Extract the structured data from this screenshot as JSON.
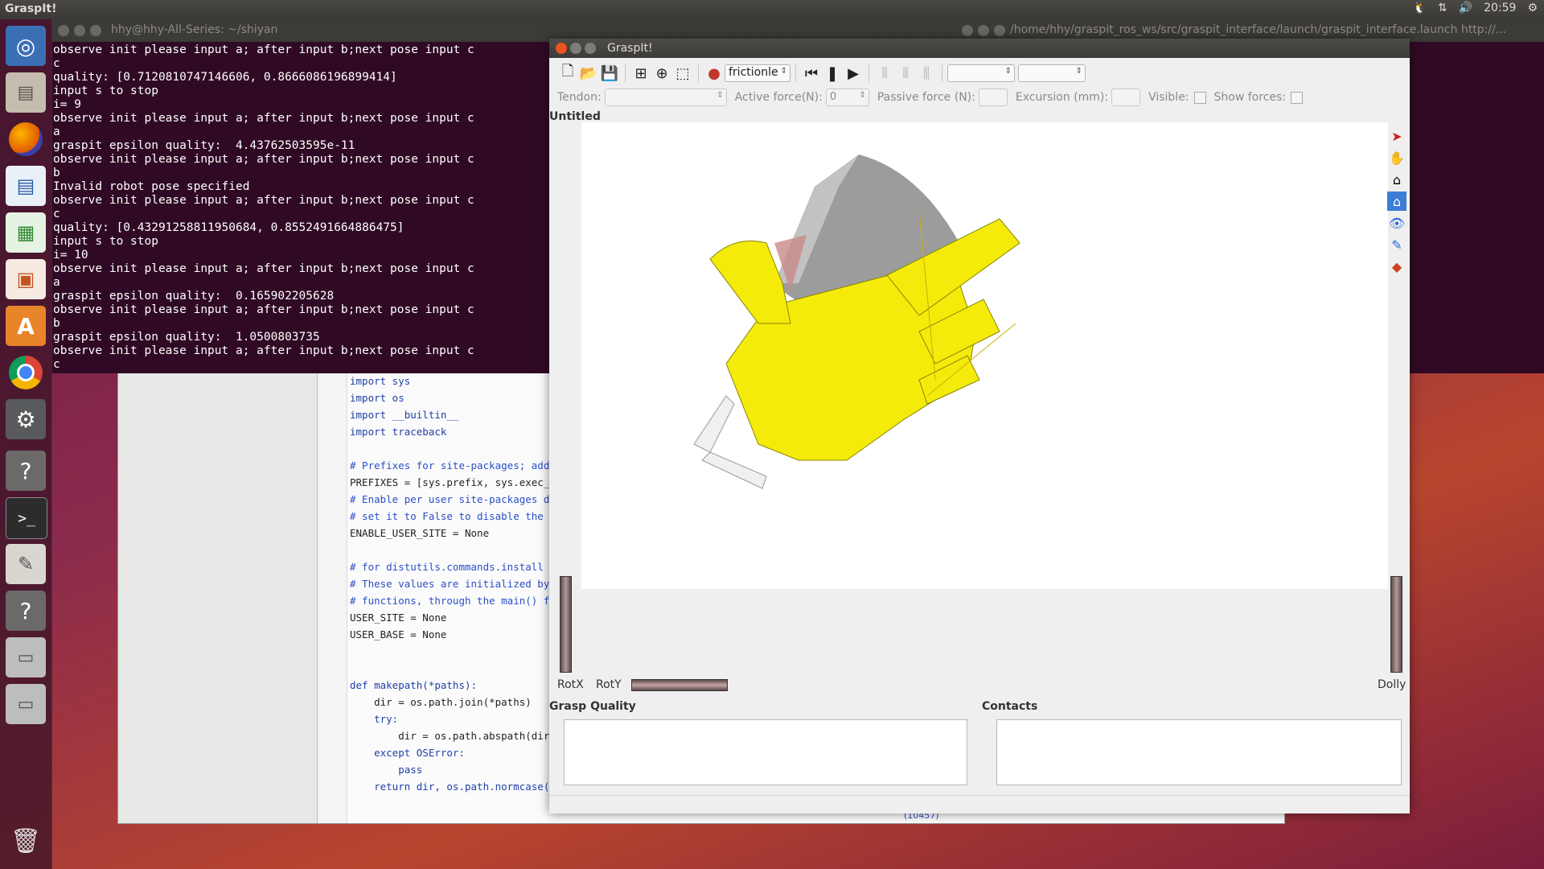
{
  "top_panel": {
    "app_title": "GraspIt!",
    "clock": "20:59"
  },
  "launcher": {
    "items": [
      {
        "icon": "ubuntu-logo-icon"
      },
      {
        "icon": "file-manager-icon"
      },
      {
        "icon": "firefox-icon"
      },
      {
        "icon": "writer-icon"
      },
      {
        "icon": "calc-icon"
      },
      {
        "icon": "impress-icon"
      },
      {
        "icon": "software-center-icon"
      },
      {
        "icon": "chrome-icon"
      },
      {
        "icon": "system-settings-icon"
      },
      {
        "icon": "help-icon"
      },
      {
        "icon": "terminal-icon"
      },
      {
        "icon": "text-editor-icon"
      },
      {
        "icon": "help-icon"
      },
      {
        "icon": "drive-icon"
      },
      {
        "icon": "drive-icon"
      },
      {
        "icon": "trash-icon"
      }
    ]
  },
  "terminal": {
    "title": "hhy@hhy-All-Series: ~/shiyan",
    "title_right": "/home/hhy/graspit_ros_ws/src/graspit_interface/launch/graspit_interface.launch http://...",
    "lines": [
      "observe init please input a; after input b;next pose input c",
      "c",
      "quality: [0.7120810747146606, 0.8666086196899414]",
      "input s to stop",
      "i= 9",
      "observe init please input a; after input b;next pose input c",
      "a",
      "graspit epsilon quality:  4.43762503595e-11",
      "observe init please input a; after input b;next pose input c",
      "b",
      "Invalid robot pose specified",
      "observe init please input a; after input b;next pose input c",
      "c",
      "quality: [0.43291258811950684, 0.8552491664886475]",
      "input s to stop",
      "i= 10",
      "observe init please input a; after input b;next pose input c",
      "a",
      "graspit epsilon quality:  0.165902205628",
      "observe init please input a; after input b;next pose input c",
      "b",
      "graspit epsilon quality:  1.0500803735",
      "observe init please input a; after input b;next pose input c",
      "c"
    ]
  },
  "editor": {
    "code_lines": [
      "import sys",
      "import os",
      "import __builtin__",
      "import traceback",
      "",
      "# Prefixes for site-packages; add a",
      "PREFIXES = [sys.prefix, sys.exec_pr",
      "# Enable per user site-packages di",
      "# set it to False to disable the fe",
      "ENABLE_USER_SITE = None",
      "",
      "# for distutils.commands.install",
      "# These values are initialized by t",
      "# functions, through the main() fun",
      "USER_SITE = None",
      "USER_BASE = None",
      "",
      "",
      "def makepath(*paths):",
      "    dir = os.path.join(*paths)",
      "    try:",
      "        dir = os.path.abspath(dir)",
      "    except OSError:",
      "        pass",
      "    return dir, os.path.normcase(di"
    ],
    "status": "(10457)"
  },
  "graspit": {
    "title": "GraspIt!",
    "friction_combo": "frictionle",
    "tendon_label": "Tendon:",
    "active_force_label": "Active force(N):",
    "active_force_value": "0",
    "passive_force_label": "Passive force (N):",
    "excursion_label": "Excursion (mm):",
    "visible_label": "Visible:",
    "show_forces_label": "Show forces:",
    "doc_title": "Untitled",
    "rotx_label": "RotX",
    "roty_label": "RotY",
    "dolly_label": "Dolly",
    "grasp_quality_title": "Grasp Quality",
    "contacts_title": "Contacts"
  }
}
